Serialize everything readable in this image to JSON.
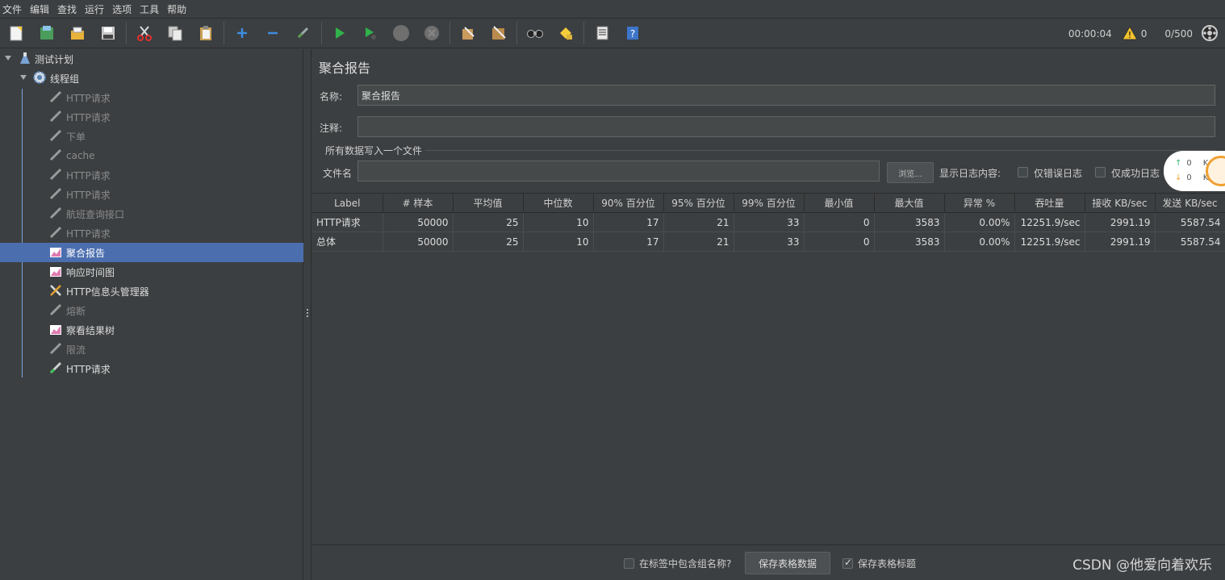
{
  "menu": [
    "文件",
    "编辑",
    "查找",
    "运行",
    "选项",
    "工具",
    "帮助"
  ],
  "toolbar_icons": [
    "new-icon",
    "templates-icon",
    "open-icon",
    "save-icon",
    "cut-icon",
    "copy-icon",
    "paste-icon",
    "expand-icon",
    "collapse-icon",
    "toggle-icon",
    "start-icon",
    "start-no-pause-icon",
    "stop-icon",
    "shutdown-icon",
    "clear-icon",
    "clear-all-icon",
    "search-icon",
    "reset-search-icon",
    "function-helper-icon",
    "help-icon"
  ],
  "status": {
    "elapsed": "00:00:04",
    "warnings": "0",
    "threads": "0/500"
  },
  "tree": [
    {
      "label": "测试计划",
      "icon": "test-plan-icon",
      "state": "enabled"
    },
    {
      "label": "线程组",
      "icon": "gear-icon",
      "state": "enabled"
    },
    {
      "label": "HTTP请求",
      "icon": "pipette-icon",
      "state": "disabled"
    },
    {
      "label": "HTTP请求",
      "icon": "pipette-icon",
      "state": "disabled"
    },
    {
      "label": "下单",
      "icon": "pipette-icon",
      "state": "disabled"
    },
    {
      "label": "cache",
      "icon": "pipette-icon",
      "state": "disabled"
    },
    {
      "label": "HTTP请求",
      "icon": "pipette-icon",
      "state": "disabled"
    },
    {
      "label": "HTTP请求",
      "icon": "pipette-icon",
      "state": "disabled"
    },
    {
      "label": "航班查询接口",
      "icon": "pipette-icon",
      "state": "disabled"
    },
    {
      "label": "HTTP请求",
      "icon": "pipette-icon",
      "state": "disabled"
    },
    {
      "label": "聚合报告",
      "icon": "chart-icon",
      "state": "selected"
    },
    {
      "label": "响应时间图",
      "icon": "chart-icon",
      "state": "enabled"
    },
    {
      "label": "HTTP信息头管理器",
      "icon": "tools-icon",
      "state": "enabled"
    },
    {
      "label": "熔断",
      "icon": "pipette-icon",
      "state": "disabled"
    },
    {
      "label": "察看结果树",
      "icon": "chart-icon",
      "state": "enabled"
    },
    {
      "label": "限流",
      "icon": "pipette-icon",
      "state": "disabled"
    },
    {
      "label": "HTTP请求",
      "icon": "pipette-green-icon",
      "state": "enabled"
    }
  ],
  "panel": {
    "title": "聚合报告",
    "name_label": "名称:",
    "name_value": "聚合报告",
    "comment_label": "注释:",
    "comment_value": "",
    "group_title": "所有数据写入一个文件",
    "filename_label": "文件名",
    "filename_value": "",
    "browse_label": "浏览...",
    "log_label": "显示日志内容:",
    "errors_only": "仅错误日志",
    "success_only": "仅成功日志"
  },
  "speed": {
    "up": "0",
    "down": "0",
    "unit": "K/s"
  },
  "table": {
    "headers": [
      "Label",
      "# 样本",
      "平均值",
      "中位数",
      "90% 百分位",
      "95% 百分位",
      "99% 百分位",
      "最小值",
      "最大值",
      "异常 %",
      "吞吐量",
      "接收 KB/sec",
      "发送 KB/sec"
    ],
    "rows": [
      [
        "HTTP请求",
        "50000",
        "25",
        "10",
        "17",
        "21",
        "33",
        "0",
        "3583",
        "0.00%",
        "12251.9/sec",
        "2991.19",
        "5587.54"
      ],
      [
        "总体",
        "50000",
        "25",
        "10",
        "17",
        "21",
        "33",
        "0",
        "3583",
        "0.00%",
        "12251.9/sec",
        "2991.19",
        "5587.54"
      ]
    ]
  },
  "footer": {
    "include_group": "在标签中包含组名称?",
    "save_table": "保存表格数据",
    "save_header": "保存表格标题"
  },
  "watermark": "CSDN @他爱向着欢乐"
}
